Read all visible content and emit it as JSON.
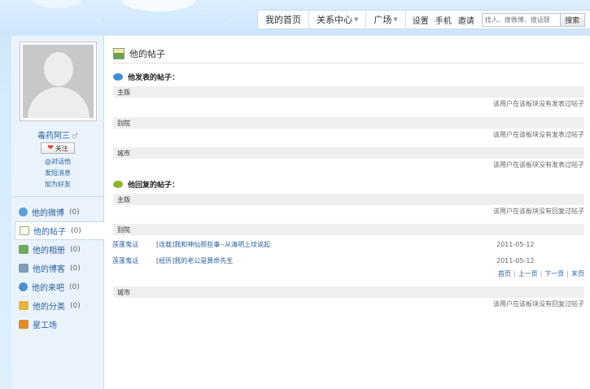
{
  "topnav": {
    "home": "我的首页",
    "relations": "关系中心",
    "plaza": "广场",
    "settings": "设置",
    "mobile": "手机",
    "invite": "邀请",
    "search_placeholder": "找人、搜微博、搜话题",
    "search_button": "搜索"
  },
  "profile": {
    "username": "毒药阿三",
    "follow_label": "关注",
    "links": [
      "@对话他",
      "发短消息",
      "加为好友"
    ]
  },
  "menu": [
    {
      "label": "他的微博",
      "count": "(0)",
      "icon_color": "#5aa0d8"
    },
    {
      "label": "他的帖子",
      "count": "(0)",
      "icon_color": "#8ab45a"
    },
    {
      "label": "他的相册",
      "count": "(0)",
      "icon_color": "#6fa85a"
    },
    {
      "label": "他的博客",
      "count": "(0)",
      "icon_color": "#7d9cb8"
    },
    {
      "label": "他的来吧",
      "count": "(0)",
      "icon_color": "#4f8fd0"
    },
    {
      "label": "他的分类",
      "count": "(0)",
      "icon_color": "#e3b53f"
    },
    {
      "label": "星工场",
      "count": "",
      "icon_color": "#e08a2e"
    }
  ],
  "main": {
    "title": "他的帖子",
    "published": {
      "title": "他发表的帖子：",
      "sections": [
        {
          "name": "主版",
          "empty": "该用户在该板块没有发表过帖子"
        },
        {
          "name": "别院",
          "empty": "该用户在该板块没有发表过帖子"
        },
        {
          "name": "城市",
          "empty": "该用户在该板块没有发表过帖子"
        }
      ]
    },
    "replied": {
      "title": "他回复的帖子：",
      "main_section": {
        "name": "主版",
        "empty": "该用户在该板块没有回复过帖子"
      },
      "yard_section": {
        "name": "别院",
        "posts": [
          {
            "forum": "莲蓬鬼话",
            "title": "[连载]我和神仙那些事--从清明上坟说起",
            "date": "2011-05-12"
          },
          {
            "forum": "莲蓬鬼话",
            "title": "[经历]我的老公是算命先生",
            "date": "2011-05-12"
          }
        ],
        "pager": [
          "首页",
          "上一页",
          "下一页",
          "末页"
        ]
      },
      "city_section": {
        "name": "城市",
        "empty": "该用户在该板块没有回复过帖子"
      }
    }
  }
}
